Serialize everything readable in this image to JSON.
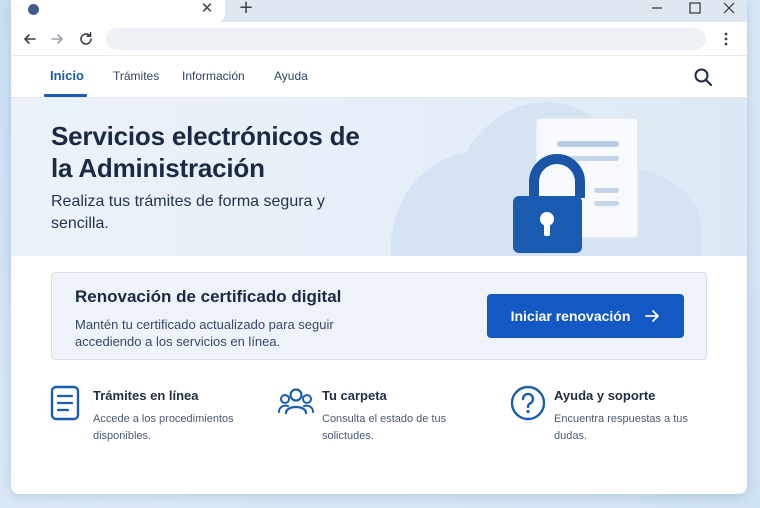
{
  "browser": {
    "tab_close_glyph": "✕",
    "new_tab_glyph": "+"
  },
  "nav": {
    "items": [
      {
        "label": "Inicio",
        "active": true
      },
      {
        "label": "Trámites"
      },
      {
        "label": "Información"
      },
      {
        "label": "Ayuda"
      }
    ],
    "search_icon": "search-icon"
  },
  "hero": {
    "title": "Servicios electrónicos de la Administración",
    "subtitle": "Realiza tus trámites de forma segura y sencilla."
  },
  "renewal": {
    "title": "Renovación de certificado digital",
    "text": "Mantén tu certificado actualizado para seguir accediendo a los servicios en línea.",
    "button_label": "Iniciar renovación"
  },
  "features": [
    {
      "icon": "document-list-icon",
      "title": "Trámites en línea",
      "text": "Accede a los procedimientos disponibles."
    },
    {
      "icon": "users-icon",
      "title": "Tu carpeta",
      "text": "Consulta el estado de tus solictudes."
    },
    {
      "icon": "help-circle-icon",
      "title": "Ayuda y soporte",
      "text": "Encuentra respuestas a tus dudas."
    }
  ],
  "colors": {
    "accent": "#1459c3",
    "nav_active": "#1a5cae",
    "heading": "#1b2a44"
  }
}
